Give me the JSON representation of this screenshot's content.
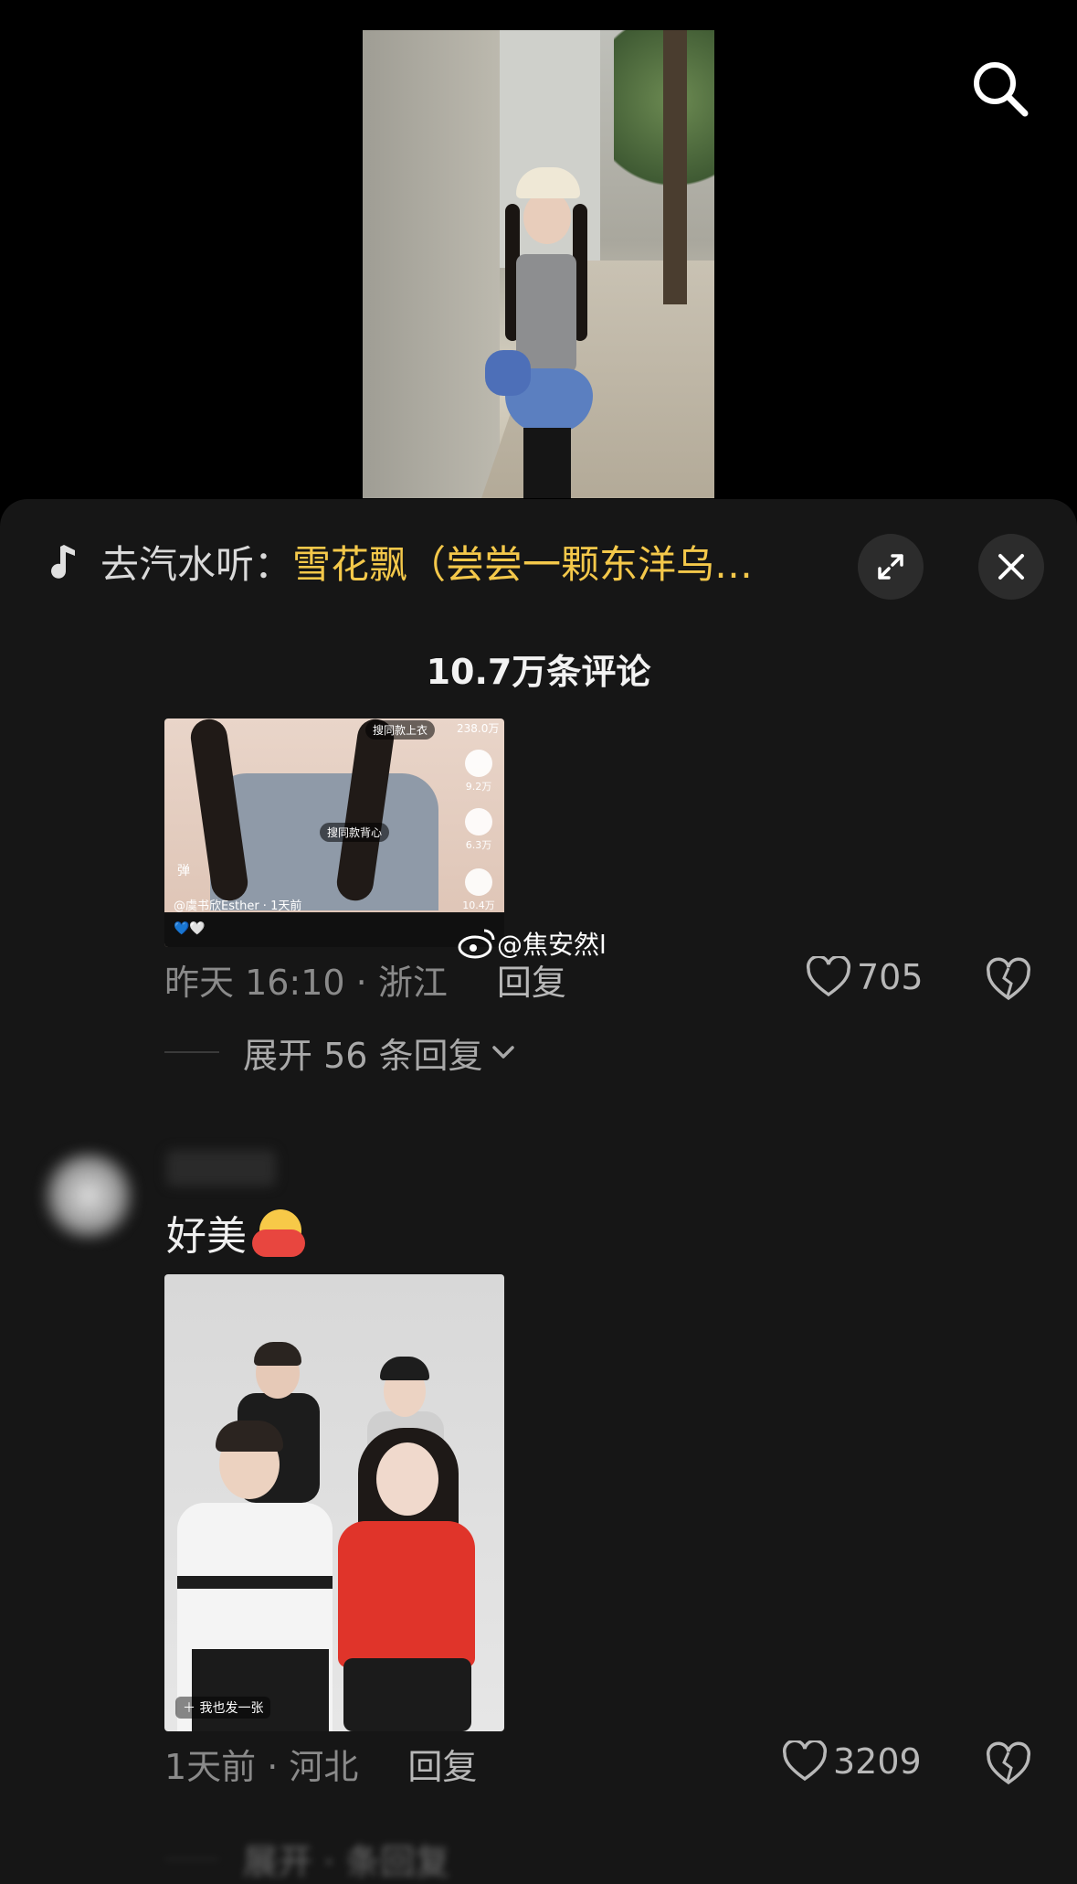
{
  "music": {
    "prefix": "去汽水听：",
    "title": "雪花飘（尝尝一颗东洋乌…"
  },
  "comments_header": {
    "count_label": "10.7万条评论"
  },
  "comment1": {
    "image_overlay": {
      "chip_top": "搜同款上衣",
      "views": "238.0万",
      "comments": "9.2万",
      "stars": "6.3万",
      "shares": "10.4万",
      "chip_mid": "搜同款背心",
      "danmu": "弹",
      "author": "@虞书欣Esther · 1天前",
      "hearts": "💙🤍"
    },
    "watermark": "@焦安然l",
    "meta": "昨天 16:10 · 浙江",
    "reply_label": "回复",
    "likes": "705",
    "expand_label": "展开 56 条回复"
  },
  "comment2": {
    "text": "好美",
    "image_overlay": {
      "add_label": "我也发一张"
    },
    "meta": "1天前 · 河北",
    "reply_label": "回复",
    "likes": "3209"
  },
  "footer": {
    "faded_text": "展开 · 条回复"
  },
  "icons": {
    "search": "search-icon",
    "music": "music-note-icon",
    "expand": "expand-icon",
    "close": "close-icon",
    "like": "heart-outline-icon",
    "dislike": "broken-heart-icon",
    "chevron": "chevron-down-icon",
    "weibo": "weibo-icon"
  },
  "colors": {
    "panel_bg": "#161616",
    "music_title": "#f4c84a",
    "meta_text": "#8a8a8a"
  }
}
